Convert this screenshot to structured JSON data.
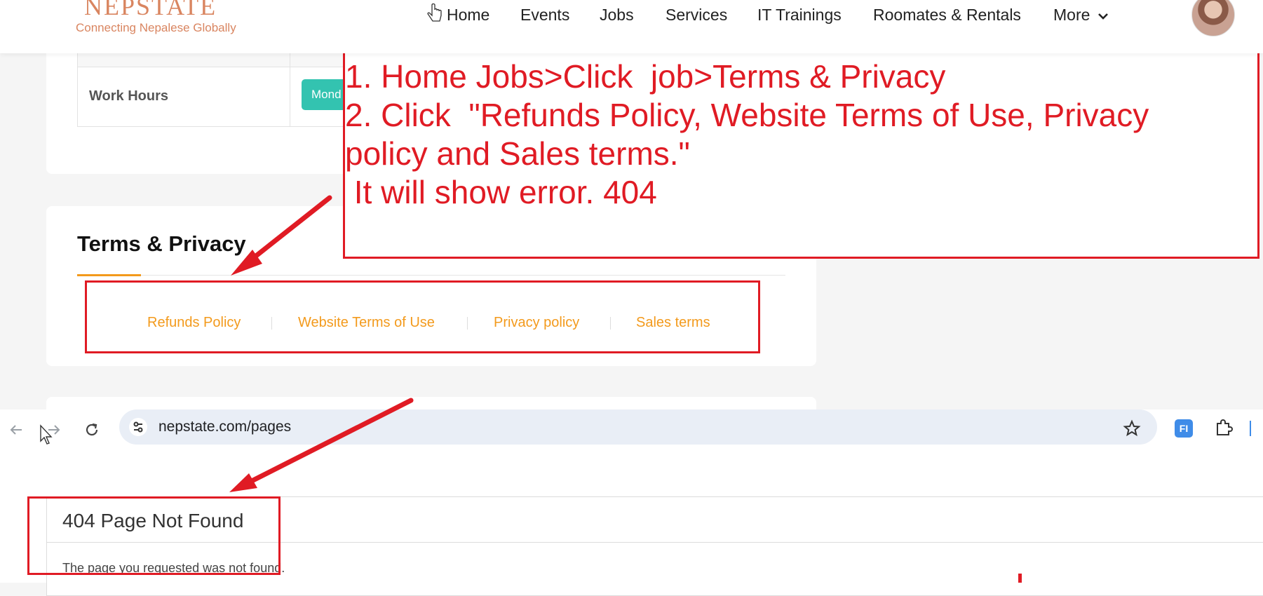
{
  "header": {
    "logo_name": "NEPSTATE",
    "logo_tagline": "Connecting Nepalese Globally",
    "nav": [
      "Home",
      "Events",
      "Jobs",
      "Services",
      "IT Trainings",
      "Roomates & Rentals",
      "More"
    ],
    "more_icon": "chevron-down-icon",
    "avatar_icon": "user-avatar"
  },
  "job_details": {
    "work_hours_label": "Work Hours",
    "work_hours_chip": "Mond"
  },
  "terms": {
    "title": "Terms & Privacy",
    "links": [
      "Refunds Policy",
      "Website Terms of Use",
      "Privacy policy",
      "Sales terms"
    ]
  },
  "browser": {
    "url": "nepstate.com/pages",
    "icons": [
      "back-arrow-icon",
      "forward-arrow-icon",
      "reload-icon",
      "site-settings-icon",
      "bookmark-star-icon",
      "extension-badge-icon",
      "extensions-puzzle-icon"
    ],
    "extension_badge": "FI"
  },
  "error_page": {
    "title": "404 Page Not Found",
    "message": "The page you requested was not found."
  },
  "annotation": {
    "lines": [
      "1. Home Jobs>Click  job>Terms & Privacy",
      "2. Click  \"Refunds Policy, Website Terms of Use, Privacy",
      "policy and Sales terms.\"",
      " It will show error. 404"
    ],
    "color": "#e01b24"
  },
  "colors": {
    "brand": "#d98560",
    "link": "#f39a1c",
    "chip": "#33c3b0"
  }
}
